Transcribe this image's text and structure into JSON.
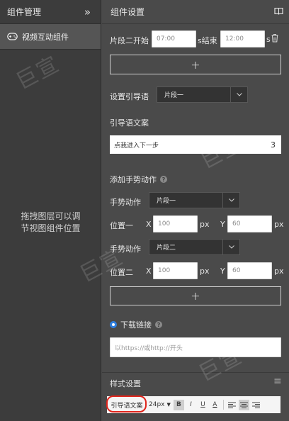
{
  "left_panel": {
    "title": "组件管理",
    "collapse_glyph": "»",
    "item_label": "视频互动组件",
    "hint_line1": "拖拽图层可以调",
    "hint_line2": "节视图组件位置"
  },
  "right_panel": {
    "title": "组件设置",
    "segment": {
      "label": "片段二开始",
      "start_value": "07:00",
      "start_unit": "s结束",
      "end_value": "12:00",
      "end_unit": "s"
    },
    "plus_glyph": "+",
    "guide": {
      "label": "设置引导语",
      "selected": "片段一"
    },
    "guide_text": {
      "label": "引导语文案",
      "value": "点我进入下一步",
      "count": "3"
    },
    "gesture_section_label": "添加手势动作",
    "gesture1": {
      "label": "手势动作",
      "selected": "片段一",
      "pos_label": "位置一",
      "x_label": "X",
      "x_value": "100",
      "x_unit": "px",
      "y_label": "Y",
      "y_value": "60",
      "y_unit": "px"
    },
    "gesture2": {
      "label": "手势动作",
      "selected": "片段二",
      "pos_label": "位置二",
      "x_label": "X",
      "x_value": "100",
      "x_unit": "px",
      "y_label": "Y",
      "y_value": "60",
      "y_unit": "px"
    },
    "download": {
      "label": "下载链接",
      "placeholder": "以https://或http://开头"
    },
    "style_section": {
      "label": "样式设置",
      "menu_glyph": "≡"
    },
    "toolbar": {
      "font_style": "引导语文案",
      "font_size": "24px",
      "bold": "B",
      "italic": "I",
      "underline": "U",
      "color_letter": "A"
    }
  },
  "watermark": {
    "text": "巨宣"
  },
  "colors": {
    "highlight_ring": "#e0241b",
    "radio_blue": "#2f7fe0"
  }
}
